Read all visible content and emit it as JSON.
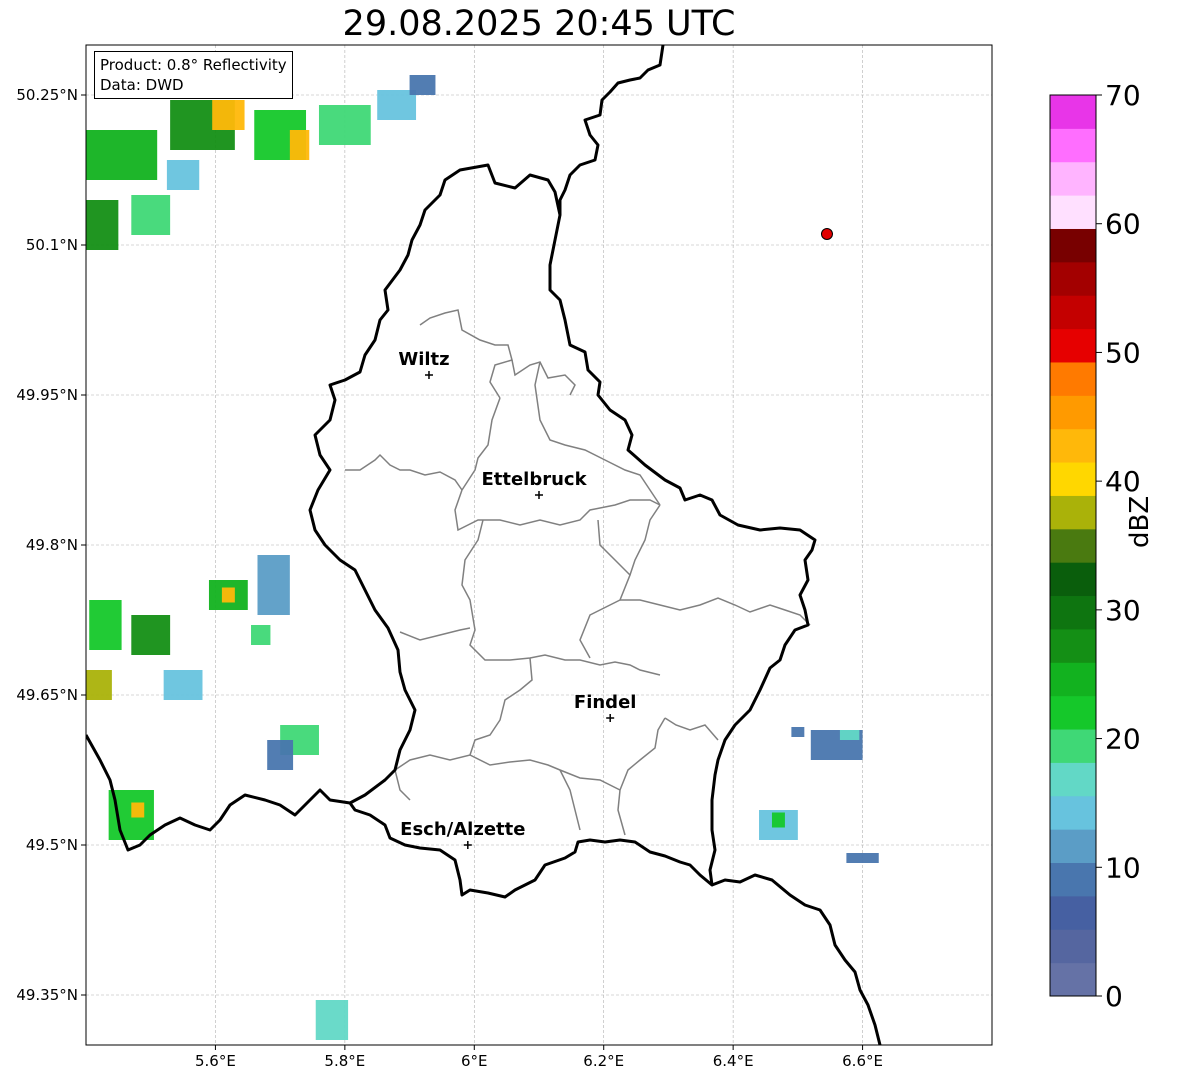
{
  "title": "29.08.2025 20:45 UTC",
  "legend": {
    "product": "Product: 0.8° Reflectivity",
    "data": "Data: DWD"
  },
  "axes": {
    "lon_ticks": [
      {
        "value": 5.6,
        "label": "5.6°E"
      },
      {
        "value": 5.8,
        "label": "5.8°E"
      },
      {
        "value": 6.0,
        "label": "6°E"
      },
      {
        "value": 6.2,
        "label": "6.2°E"
      },
      {
        "value": 6.4,
        "label": "6.4°E"
      },
      {
        "value": 6.6,
        "label": "6.6°E"
      }
    ],
    "lat_ticks": [
      {
        "value": 50.25,
        "label": "50.25°N"
      },
      {
        "value": 50.1,
        "label": "50.1°N"
      },
      {
        "value": 49.95,
        "label": "49.95°N"
      },
      {
        "value": 49.8,
        "label": "49.8°N"
      },
      {
        "value": 49.65,
        "label": "49.65°N"
      },
      {
        "value": 49.5,
        "label": "49.5°N"
      },
      {
        "value": 49.35,
        "label": "49.35°N"
      }
    ],
    "lon_range": [
      5.4,
      6.8
    ],
    "lat_range": [
      49.3,
      50.3
    ]
  },
  "cities": [
    {
      "name": "Wiltz",
      "lon": 5.93,
      "lat": 49.97
    },
    {
      "name": "Ettelbruck",
      "lon": 6.1,
      "lat": 49.85
    },
    {
      "name": "Findel",
      "lon": 6.21,
      "lat": 49.627
    },
    {
      "name": "Esch/Alzette",
      "lon": 5.99,
      "lat": 49.5
    }
  ],
  "marker": {
    "lon": 6.545,
    "lat": 50.111,
    "color": "#e00000"
  },
  "colorbar": {
    "label": "dBZ",
    "min": 0,
    "max": 70,
    "ticks": [
      {
        "value": 0,
        "label": "0"
      },
      {
        "value": 10,
        "label": "10"
      },
      {
        "value": 20,
        "label": "20"
      },
      {
        "value": 30,
        "label": "30"
      },
      {
        "value": 40,
        "label": "40"
      },
      {
        "value": 50,
        "label": "50"
      },
      {
        "value": 60,
        "label": "60"
      },
      {
        "value": 70,
        "label": "70"
      }
    ],
    "colors": [
      "#6572a6",
      "#5566a0",
      "#4660a2",
      "#4976ae",
      "#5b9dc6",
      "#67c3de",
      "#62d8c6",
      "#3fd876",
      "#15c82a",
      "#12b21f",
      "#148f15",
      "#0e7510",
      "#0a5e0c",
      "#4a7a10",
      "#aab209",
      "#ffd700",
      "#ffb80a",
      "#ff9a00",
      "#ff7a00",
      "#e60000",
      "#c40000",
      "#a30000",
      "#780000",
      "#ffe0ff",
      "#ffb4ff",
      "#ff6eff",
      "#e835e8"
    ]
  },
  "colors": {
    "border": "#000000",
    "cantons": "#808080",
    "grid": "#b0b0b0"
  },
  "radar_cells": [
    {
      "lon": 5.45,
      "lat": 50.19,
      "w": 0.12,
      "h": 0.05,
      "dbz": 25
    },
    {
      "lon": 5.58,
      "lat": 50.22,
      "w": 0.1,
      "h": 0.05,
      "dbz": 28
    },
    {
      "lon": 5.62,
      "lat": 50.23,
      "w": 0.05,
      "h": 0.03,
      "dbz": 42
    },
    {
      "lon": 5.7,
      "lat": 50.21,
      "w": 0.08,
      "h": 0.05,
      "dbz": 22
    },
    {
      "lon": 5.73,
      "lat": 50.2,
      "w": 0.03,
      "h": 0.03,
      "dbz": 42
    },
    {
      "lon": 5.8,
      "lat": 50.22,
      "w": 0.08,
      "h": 0.04,
      "dbz": 20
    },
    {
      "lon": 5.88,
      "lat": 50.24,
      "w": 0.06,
      "h": 0.03,
      "dbz": 14
    },
    {
      "lon": 5.92,
      "lat": 50.26,
      "w": 0.04,
      "h": 0.02,
      "dbz": 10
    },
    {
      "lon": 5.41,
      "lat": 50.12,
      "w": 0.08,
      "h": 0.05,
      "dbz": 28
    },
    {
      "lon": 5.5,
      "lat": 50.13,
      "w": 0.06,
      "h": 0.04,
      "dbz": 20
    },
    {
      "lon": 5.55,
      "lat": 50.17,
      "w": 0.05,
      "h": 0.03,
      "dbz": 14
    },
    {
      "lon": 5.43,
      "lat": 49.72,
      "w": 0.05,
      "h": 0.05,
      "dbz": 22
    },
    {
      "lon": 5.5,
      "lat": 49.71,
      "w": 0.06,
      "h": 0.04,
      "dbz": 26
    },
    {
      "lon": 5.55,
      "lat": 49.66,
      "w": 0.06,
      "h": 0.03,
      "dbz": 14
    },
    {
      "lon": 5.42,
      "lat": 49.66,
      "w": 0.04,
      "h": 0.03,
      "dbz": 38
    },
    {
      "lon": 5.62,
      "lat": 49.75,
      "w": 0.06,
      "h": 0.03,
      "dbz": 24
    },
    {
      "lon": 5.62,
      "lat": 49.75,
      "w": 0.02,
      "h": 0.015,
      "dbz": 42
    },
    {
      "lon": 5.69,
      "lat": 49.76,
      "w": 0.05,
      "h": 0.06,
      "dbz": 12
    },
    {
      "lon": 5.67,
      "lat": 49.71,
      "w": 0.03,
      "h": 0.02,
      "dbz": 20
    },
    {
      "lon": 5.47,
      "lat": 49.53,
      "w": 0.07,
      "h": 0.05,
      "dbz": 22
    },
    {
      "lon": 5.48,
      "lat": 49.535,
      "w": 0.02,
      "h": 0.015,
      "dbz": 42
    },
    {
      "lon": 5.73,
      "lat": 49.605,
      "w": 0.06,
      "h": 0.03,
      "dbz": 20
    },
    {
      "lon": 5.7,
      "lat": 49.59,
      "w": 0.04,
      "h": 0.03,
      "dbz": 10
    },
    {
      "lon": 5.78,
      "lat": 49.325,
      "w": 0.05,
      "h": 0.04,
      "dbz": 16
    },
    {
      "lon": 6.56,
      "lat": 49.6,
      "w": 0.08,
      "h": 0.03,
      "dbz": 10
    },
    {
      "lon": 6.58,
      "lat": 49.61,
      "w": 0.03,
      "h": 0.01,
      "dbz": 18
    },
    {
      "lon": 6.47,
      "lat": 49.52,
      "w": 0.06,
      "h": 0.03,
      "dbz": 14
    },
    {
      "lon": 6.47,
      "lat": 49.525,
      "w": 0.02,
      "h": 0.015,
      "dbz": 22
    },
    {
      "lon": 6.6,
      "lat": 49.487,
      "w": 0.05,
      "h": 0.01,
      "dbz": 8
    },
    {
      "lon": 6.5,
      "lat": 49.613,
      "w": 0.02,
      "h": 0.01,
      "dbz": 8
    }
  ]
}
